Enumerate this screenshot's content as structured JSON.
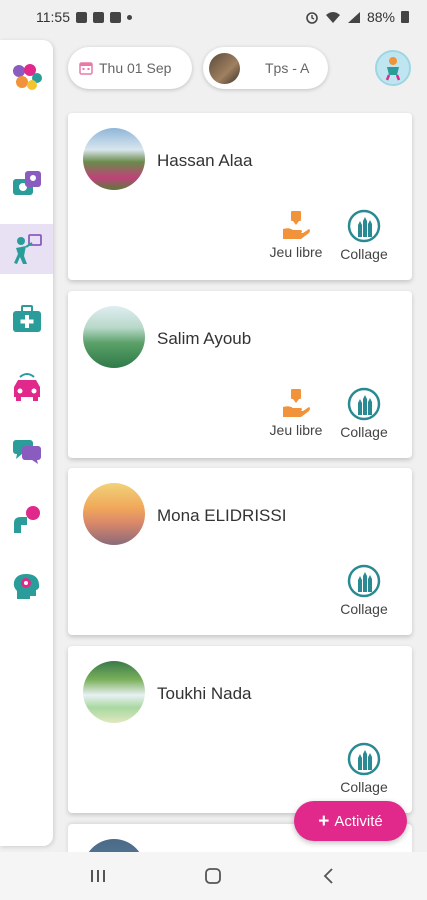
{
  "status_bar": {
    "time": "11:55",
    "battery": "88%"
  },
  "header": {
    "date": "Thu 01 Sep",
    "class_name": "Tps - A"
  },
  "children": [
    {
      "name": "Hassan Alaa",
      "activities": [
        "Jeu libre",
        "Collage"
      ]
    },
    {
      "name": "Salim Ayoub",
      "activities": [
        "Jeu libre",
        "Collage"
      ]
    },
    {
      "name": "Mona ELIDRISSI",
      "activities": [
        "Collage"
      ]
    },
    {
      "name": "Toukhi Nada",
      "activities": [
        "Collage"
      ]
    }
  ],
  "labels": {
    "jeu_libre": "Jeu libre",
    "collage": "Collage"
  },
  "fab": {
    "label": "Activité"
  },
  "colors": {
    "accent": "#e0298a",
    "teal": "#2a9d9a",
    "orange": "#f0933a",
    "purple": "#8a5cc0"
  },
  "rail_icons": [
    "logo-icon",
    "photos-icon",
    "activity-icon",
    "first-aid-icon",
    "transport-icon",
    "messages-icon",
    "participation-icon",
    "brain-icon"
  ]
}
